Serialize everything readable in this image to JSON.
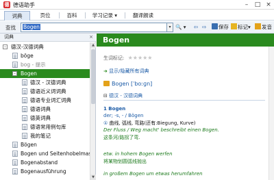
{
  "window": {
    "title": "德语助手",
    "icon_glyph": "德",
    "minimize": "–",
    "maximize": "□",
    "close": "×"
  },
  "tabs": [
    {
      "label": "词典",
      "active": true
    },
    {
      "label": "页位"
    },
    {
      "label": "百科"
    },
    {
      "label": "学习记录 ▾"
    },
    {
      "label": "翻译朗读"
    }
  ],
  "search": {
    "label": "查找",
    "value": "Bogen",
    "dropdown": "▾",
    "zoom": "🔍 ▾",
    "back": "⇦",
    "forward": "⇨",
    "save": "保存",
    "mark": "标记",
    "mark_arrow": "▾",
    "speak": "发音"
  },
  "left": {
    "header": "词典",
    "close": "×",
    "tree": [
      {
        "label": "德汉-汉德词典",
        "indent": 0,
        "expander": "–",
        "doc": false
      },
      {
        "label": "böge",
        "indent": 1,
        "doc": true
      },
      {
        "label": "bog - 提示",
        "indent": 1,
        "doc": true,
        "gray": true
      },
      {
        "label": "Bogen",
        "indent": 1,
        "expander": "–",
        "doc": false,
        "selected": true
      },
      {
        "label": "德汉 - 汉德词典",
        "indent": 2,
        "doc": true
      },
      {
        "label": "德语近义词词典",
        "indent": 2,
        "doc": true
      },
      {
        "label": "德语专业词汇词典",
        "indent": 2,
        "doc": true
      },
      {
        "label": "德语词典",
        "indent": 2,
        "doc": true
      },
      {
        "label": "德英词典",
        "indent": 2,
        "doc": true
      },
      {
        "label": "德语常用例句库",
        "indent": 2,
        "doc": true
      },
      {
        "label": "我的笔记",
        "indent": 2,
        "doc": true
      },
      {
        "label": "Bögen",
        "indent": 1,
        "doc": true
      },
      {
        "label": "Bogen und Seitenhobelmas",
        "indent": 1,
        "doc": true
      },
      {
        "label": "Bogenabstand",
        "indent": 1,
        "doc": true
      },
      {
        "label": "Bogenausführung",
        "indent": 1,
        "doc": true
      }
    ],
    "scroll_up": "▲",
    "scroll_down": "▼"
  },
  "entry": {
    "headword": "Bogen",
    "rating_label": "生词标记:",
    "stars": "★★★★★",
    "show_hide": "显示/隐藏所有词典",
    "pron_word": "Bogen",
    "pron_ipa": "[ˈboːɡn]",
    "section_title": "德汉 - 汉德词典",
    "sense_num": "1 Bogen",
    "gram": "der; -s, - / Bögen",
    "def_marker": "①",
    "def": "曲线, 弧线, 弯路(还有:Biegung, Kurve)",
    "ex1_de": "Der Fluss / Weg macht' beschreibt einen Bogen.",
    "ex1_zh": "这条河/路拐了弯.",
    "ex2_de": "etw. in hohem Bogen werfen",
    "ex2_zh": "将某物划圆弧线抛出",
    "ex3_de": "in großem Bogen um etwas herumfahren"
  },
  "colors": {
    "accent_green": "#2a8a1e",
    "link_blue": "#1a5aa6",
    "example_green": "#1c7a1c"
  }
}
